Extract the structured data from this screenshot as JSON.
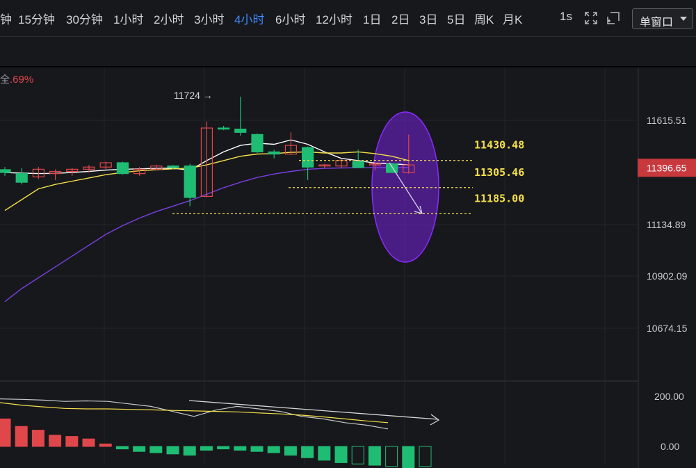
{
  "toolbar": {
    "timeframes": [
      "钟",
      "15分钟",
      "30分钟",
      "1小时",
      "2小时",
      "3小时",
      "4小时",
      "6小时",
      "12小时",
      "1日",
      "2日",
      "3日",
      "5日",
      "周K",
      "月K"
    ],
    "active_timeframe": "4小时",
    "refresh": "1s",
    "window_mode": "单窗口"
  },
  "colors": {
    "background": "#17181c",
    "up": "#e0474b",
    "down": "#1fbd74",
    "ma_fast": "#ffffff",
    "ma_mid": "#f5e04a",
    "ma_slow": "#7a3fe0",
    "highlight_ellipse": "#6a22c8",
    "level_line": "#f5e04a",
    "price_tag": "#c8393d",
    "active_tab": "#3d8bff"
  },
  "icons": [
    "expand-icon",
    "fullscreen-icon"
  ],
  "chart_data": {
    "type": "candlestick",
    "top_left_text": "全",
    "top_left_change": ".69%",
    "price_axis": {
      "ticks": [
        11615.51,
        11134.89,
        10902.09,
        10674.15
      ],
      "tick_labels": [
        "11615.51",
        "11134.89",
        "10902.09",
        "10674.15"
      ]
    },
    "current_price": 11396.65,
    "current_price_label": "11396.65",
    "high_marker": {
      "value": 11724,
      "label": "11724 →"
    },
    "support_levels": [
      {
        "value": 11430.48,
        "label": "11430.48"
      },
      {
        "value": 11305.46,
        "label": "11305.46"
      },
      {
        "value": 11185.0,
        "label": "11185.00"
      }
    ],
    "candles": [
      {
        "o": 11388,
        "h": 11400,
        "l": 11360,
        "c": 11375
      },
      {
        "o": 11370,
        "h": 11395,
        "l": 11320,
        "c": 11330
      },
      {
        "o": 11355,
        "h": 11400,
        "l": 11345,
        "c": 11390
      },
      {
        "o": 11370,
        "h": 11390,
        "l": 11340,
        "c": 11380
      },
      {
        "o": 11380,
        "h": 11395,
        "l": 11360,
        "c": 11390
      },
      {
        "o": 11390,
        "h": 11410,
        "l": 11375,
        "c": 11400
      },
      {
        "o": 11400,
        "h": 11425,
        "l": 11390,
        "c": 11420
      },
      {
        "o": 11420,
        "h": 11425,
        "l": 11365,
        "c": 11370
      },
      {
        "o": 11370,
        "h": 11400,
        "l": 11360,
        "c": 11390
      },
      {
        "o": 11390,
        "h": 11410,
        "l": 11385,
        "c": 11405
      },
      {
        "o": 11405,
        "h": 11410,
        "l": 11390,
        "c": 11398
      },
      {
        "o": 11405,
        "h": 11415,
        "l": 11220,
        "c": 11260
      },
      {
        "o": 11265,
        "h": 11610,
        "l": 11260,
        "c": 11580
      },
      {
        "o": 11580,
        "h": 11590,
        "l": 11570,
        "c": 11575
      },
      {
        "o": 11575,
        "h": 11724,
        "l": 11545,
        "c": 11560
      },
      {
        "o": 11550,
        "h": 11555,
        "l": 11465,
        "c": 11470
      },
      {
        "o": 11470,
        "h": 11480,
        "l": 11440,
        "c": 11460
      },
      {
        "o": 11460,
        "h": 11560,
        "l": 11455,
        "c": 11500
      },
      {
        "o": 11490,
        "h": 11495,
        "l": 11340,
        "c": 11400
      },
      {
        "o": 11405,
        "h": 11415,
        "l": 11395,
        "c": 11410
      },
      {
        "o": 11405,
        "h": 11440,
        "l": 11395,
        "c": 11430
      },
      {
        "o": 11425,
        "h": 11480,
        "l": 11395,
        "c": 11398
      },
      {
        "o": 11410,
        "h": 11420,
        "l": 11385,
        "c": 11415
      },
      {
        "o": 11415,
        "h": 11420,
        "l": 11375,
        "c": 11375
      },
      {
        "o": 11375,
        "h": 11550,
        "l": 11370,
        "c": 11410
      }
    ],
    "ma_lines": [
      {
        "color": "#ffffff",
        "values": [
          11375,
          11372,
          11370,
          11371,
          11375,
          11380,
          11386,
          11390,
          11392,
          11394,
          11395,
          11385,
          11430,
          11470,
          11500,
          11510,
          11505,
          11525,
          11505,
          11470,
          11440,
          11430,
          11418,
          11415,
          11410
        ]
      },
      {
        "color": "#f5e04a",
        "values": [
          11200,
          11250,
          11300,
          11320,
          11335,
          11350,
          11365,
          11375,
          11383,
          11388,
          11392,
          11395,
          11410,
          11430,
          11450,
          11460,
          11462,
          11468,
          11470,
          11465,
          11465,
          11470,
          11462,
          11450,
          11430
        ]
      },
      {
        "color": "#7a3fe0",
        "values": [
          10780,
          10840,
          10890,
          10940,
          10990,
          11040,
          11090,
          11130,
          11165,
          11195,
          11220,
          11245,
          11275,
          11305,
          11330,
          11352,
          11368,
          11380,
          11390,
          11394,
          11396,
          11397,
          11398,
          11398,
          11398
        ]
      }
    ],
    "indicator": {
      "axis_ticks": [
        "200.00",
        "0.00"
      ],
      "histogram": [
        110,
        80,
        65,
        45,
        40,
        30,
        10,
        -10,
        -20,
        -25,
        -30,
        -35,
        -15,
        -10,
        -15,
        -20,
        -25,
        -35,
        -45,
        -55,
        -65,
        -70,
        -75,
        -80,
        -85,
        -80
      ],
      "histogram_axis_max": 200,
      "dif_line": [
        190,
        188,
        185,
        180,
        182,
        180,
        170,
        160,
        140,
        120,
        145,
        160,
        150,
        140,
        120,
        110,
        95,
        85,
        70
      ],
      "dea_line": [
        175,
        165,
        158,
        152,
        150,
        150,
        148,
        146,
        144,
        142,
        140,
        138,
        134,
        130,
        125,
        118,
        110,
        102,
        95
      ]
    }
  }
}
